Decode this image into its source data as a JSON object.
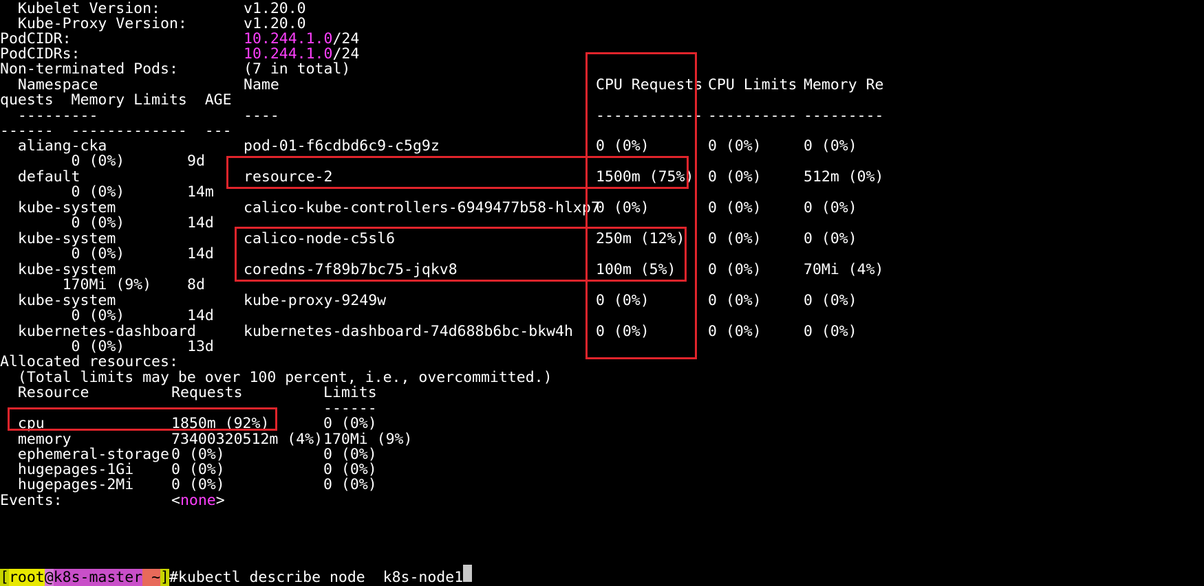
{
  "lines": [
    {
      "a": "  Kubelet Version:",
      "b": "v1.20.0"
    },
    {
      "a": "  Kube-Proxy Version:",
      "b": "v1.20.0"
    },
    {
      "a": "PodCIDR:",
      "ip": "10.244.1.0",
      "suffix": "/24"
    },
    {
      "a": "PodCIDRs:",
      "ip": "10.244.1.0",
      "suffix": "/24"
    },
    {
      "a": "Non-terminated Pods:",
      "b": "(7 in total)"
    }
  ],
  "pods_header": {
    "namespace": "  Namespace",
    "name": "Name",
    "cpu_requests": "CPU Requests",
    "cpu_limits": "CPU Limits",
    "memory_requests_part1": "Memory Re",
    "wrap_line": "quests  Memory Limits  AGE",
    "sep_namespace": "  ---------",
    "sep_name": "----",
    "sep_cpu_requests": "------------",
    "sep_cpu_limits": "----------",
    "sep_memory_requests": "---------",
    "sep_wrap": "------  -------------  ---"
  },
  "pods": [
    {
      "namespace": "  aliang-cka",
      "name": "pod-01-f6cdbd6c9-c5g9z",
      "cpu_req": "0 (0%)",
      "cpu_lim": "0 (0%)",
      "mem_req": "0 (0%)",
      "mem_lim": "        0 (0%)",
      "age": "9d"
    },
    {
      "namespace": "  default",
      "name": "resource-2",
      "cpu_req": "1500m (75%)",
      "cpu_lim": "0 (0%)",
      "mem_req": "512m (0%)",
      "mem_lim": "        0 (0%)",
      "age": "14m"
    },
    {
      "namespace": "  kube-system",
      "name": "calico-kube-controllers-6949477b58-hlxp7",
      "cpu_req": "0 (0%)",
      "cpu_lim": "0 (0%)",
      "mem_req": "0 (0%)",
      "mem_lim": "        0 (0%)",
      "age": "14d"
    },
    {
      "namespace": "  kube-system",
      "name": "calico-node-c5sl6",
      "cpu_req": "250m (12%)",
      "cpu_lim": "0 (0%)",
      "mem_req": "0 (0%)",
      "mem_lim": "        0 (0%)",
      "age": "14d"
    },
    {
      "namespace": "  kube-system",
      "name": "coredns-7f89b7bc75-jqkv8",
      "cpu_req": "100m (5%)",
      "cpu_lim": "0 (0%)",
      "mem_req": "70Mi (4%)",
      "mem_lim": "       170Mi (9%)",
      "age": "8d"
    },
    {
      "namespace": "  kube-system",
      "name": "kube-proxy-9249w",
      "cpu_req": "0 (0%)",
      "cpu_lim": "0 (0%)",
      "mem_req": "0 (0%)",
      "mem_lim": "        0 (0%)",
      "age": "14d"
    },
    {
      "namespace": "  kubernetes-dashboard",
      "name": "kubernetes-dashboard-74d688b6bc-bkw4h",
      "cpu_req": "0 (0%)",
      "cpu_lim": "0 (0%)",
      "mem_req": "0 (0%)",
      "mem_lim": "        0 (0%)",
      "age": "13d"
    }
  ],
  "allocated": {
    "title": "Allocated resources:",
    "note": "  (Total limits may be over 100 percent, i.e., overcommitted.)",
    "header": {
      "resource": "  Resource",
      "requests": "Requests",
      "limits": "Limits"
    },
    "sep_limits": "------",
    "rows": [
      {
        "resource": "  cpu",
        "requests": "1850m (92%)",
        "limits": "0 (0%)"
      },
      {
        "resource": "  memory",
        "requests": "73400320512m (4%)",
        "limits": "170Mi (9%)"
      },
      {
        "resource": "  ephemeral-storage",
        "requests": "0 (0%)",
        "limits": "0 (0%)"
      },
      {
        "resource": "  hugepages-1Gi",
        "requests": "0 (0%)",
        "limits": "0 (0%)"
      },
      {
        "resource": "  hugepages-2Mi",
        "requests": "0 (0%)",
        "limits": "0 (0%)"
      }
    ]
  },
  "events": {
    "label": "Events:",
    "open": "<",
    "value": "none",
    "close": ">"
  },
  "prompt": {
    "open": "[",
    "user": "root",
    "at": "@",
    "host": "k8s-master",
    "path": " ~",
    "close": "]",
    "command": "#kubectl describe node  k8s-node1"
  },
  "colors": {
    "background": "#000000",
    "text": "#ffffff",
    "magenta": "#ff40ff",
    "highlight_box": "#e0242b"
  }
}
